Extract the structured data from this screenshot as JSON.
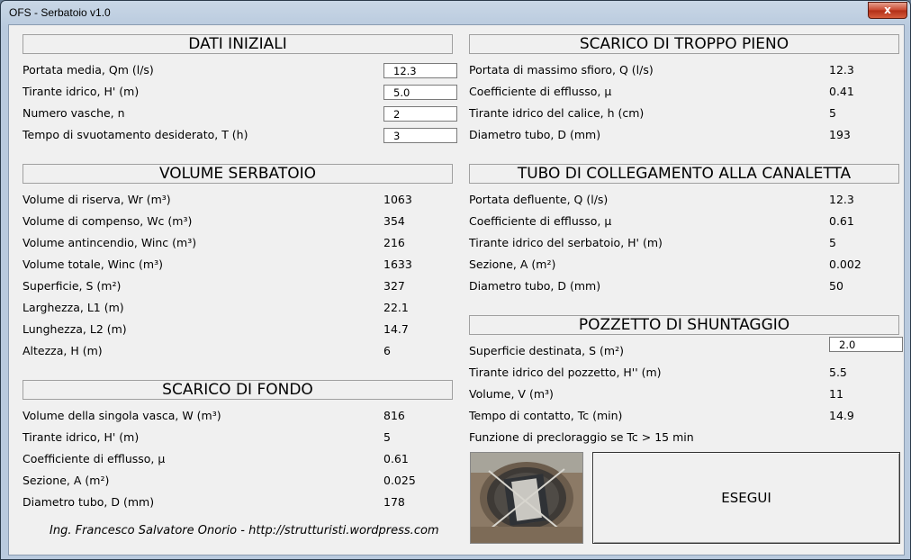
{
  "window": {
    "title": "OFS - Serbatoio v1.0",
    "close_glyph": "x"
  },
  "dati_iniziali": {
    "header": "DATI INIZIALI",
    "rows": [
      {
        "label": "Portata media, Qm (l/s)",
        "value": "12.3"
      },
      {
        "label": "Tirante idrico, H' (m)",
        "value": "5.0"
      },
      {
        "label": "Numero vasche, n",
        "value": "2"
      },
      {
        "label": "Tempo di svuotamento desiderato, T (h)",
        "value": "3"
      }
    ]
  },
  "volume_serbatoio": {
    "header": "VOLUME SERBATOIO",
    "rows": [
      {
        "label": "Volume di riserva, Wr (m³)",
        "value": "1063"
      },
      {
        "label": "Volume di compenso, Wc (m³)",
        "value": "354"
      },
      {
        "label": "Volume antincendio, Winc (m³)",
        "value": "216"
      },
      {
        "label": "Volume totale, Winc (m³)",
        "value": "1633"
      },
      {
        "label": "Superficie, S (m²)",
        "value": "327"
      },
      {
        "label": "Larghezza, L1 (m)",
        "value": "22.1"
      },
      {
        "label": "Lunghezza, L2 (m)",
        "value": "14.7"
      },
      {
        "label": "Altezza, H (m)",
        "value": "6"
      }
    ]
  },
  "scarico_fondo": {
    "header": "SCARICO DI FONDO",
    "rows": [
      {
        "label": "Volume della singola vasca, W (m³)",
        "value": "816"
      },
      {
        "label": "Tirante idrico, H' (m)",
        "value": "5"
      },
      {
        "label": "Coefficiente di efflusso, μ",
        "value": "0.61"
      },
      {
        "label": "Sezione, A (m²)",
        "value": "0.025"
      },
      {
        "label": "Diametro tubo, D (mm)",
        "value": "178"
      }
    ]
  },
  "troppo_pieno": {
    "header": "SCARICO DI TROPPO PIENO",
    "rows": [
      {
        "label": "Portata di massimo sfioro, Q (l/s)",
        "value": "12.3"
      },
      {
        "label": "Coefficiente di efflusso, μ",
        "value": "0.41"
      },
      {
        "label": "Tirante idrico del calice, h (cm)",
        "value": "5"
      },
      {
        "label": "Diametro tubo, D (mm)",
        "value": "193"
      }
    ]
  },
  "tubo_canaletta": {
    "header": "TUBO DI COLLEGAMENTO ALLA CANALETTA",
    "rows": [
      {
        "label": "Portata defluente, Q (l/s)",
        "value": "12.3"
      },
      {
        "label": "Coefficiente di efflusso, μ",
        "value": "0.61"
      },
      {
        "label": "Tirante idrico del serbatoio, H' (m)",
        "value": "5"
      },
      {
        "label": "Sezione, A (m²)",
        "value": "0.002"
      },
      {
        "label": "Diametro tubo, D (mm)",
        "value": "50"
      }
    ]
  },
  "pozzetto": {
    "header": "POZZETTO DI SHUNTAGGIO",
    "input_label": "Superficie destinata, S (m²)",
    "input_value": "2.0",
    "rows": [
      {
        "label": "Tirante idrico del pozzetto, H'' (m)",
        "value": "5.5"
      },
      {
        "label": "Volume, V (m³)",
        "value": "11"
      },
      {
        "label": "Tempo di contatto, Tc (min)",
        "value": "14.9"
      }
    ],
    "note": "Funzione di precloraggio se Tc > 15 min"
  },
  "execute_button": "ESEGUI",
  "footer": "Ing. Francesco Salvatore Onorio - http://strutturisti.wordpress.com"
}
